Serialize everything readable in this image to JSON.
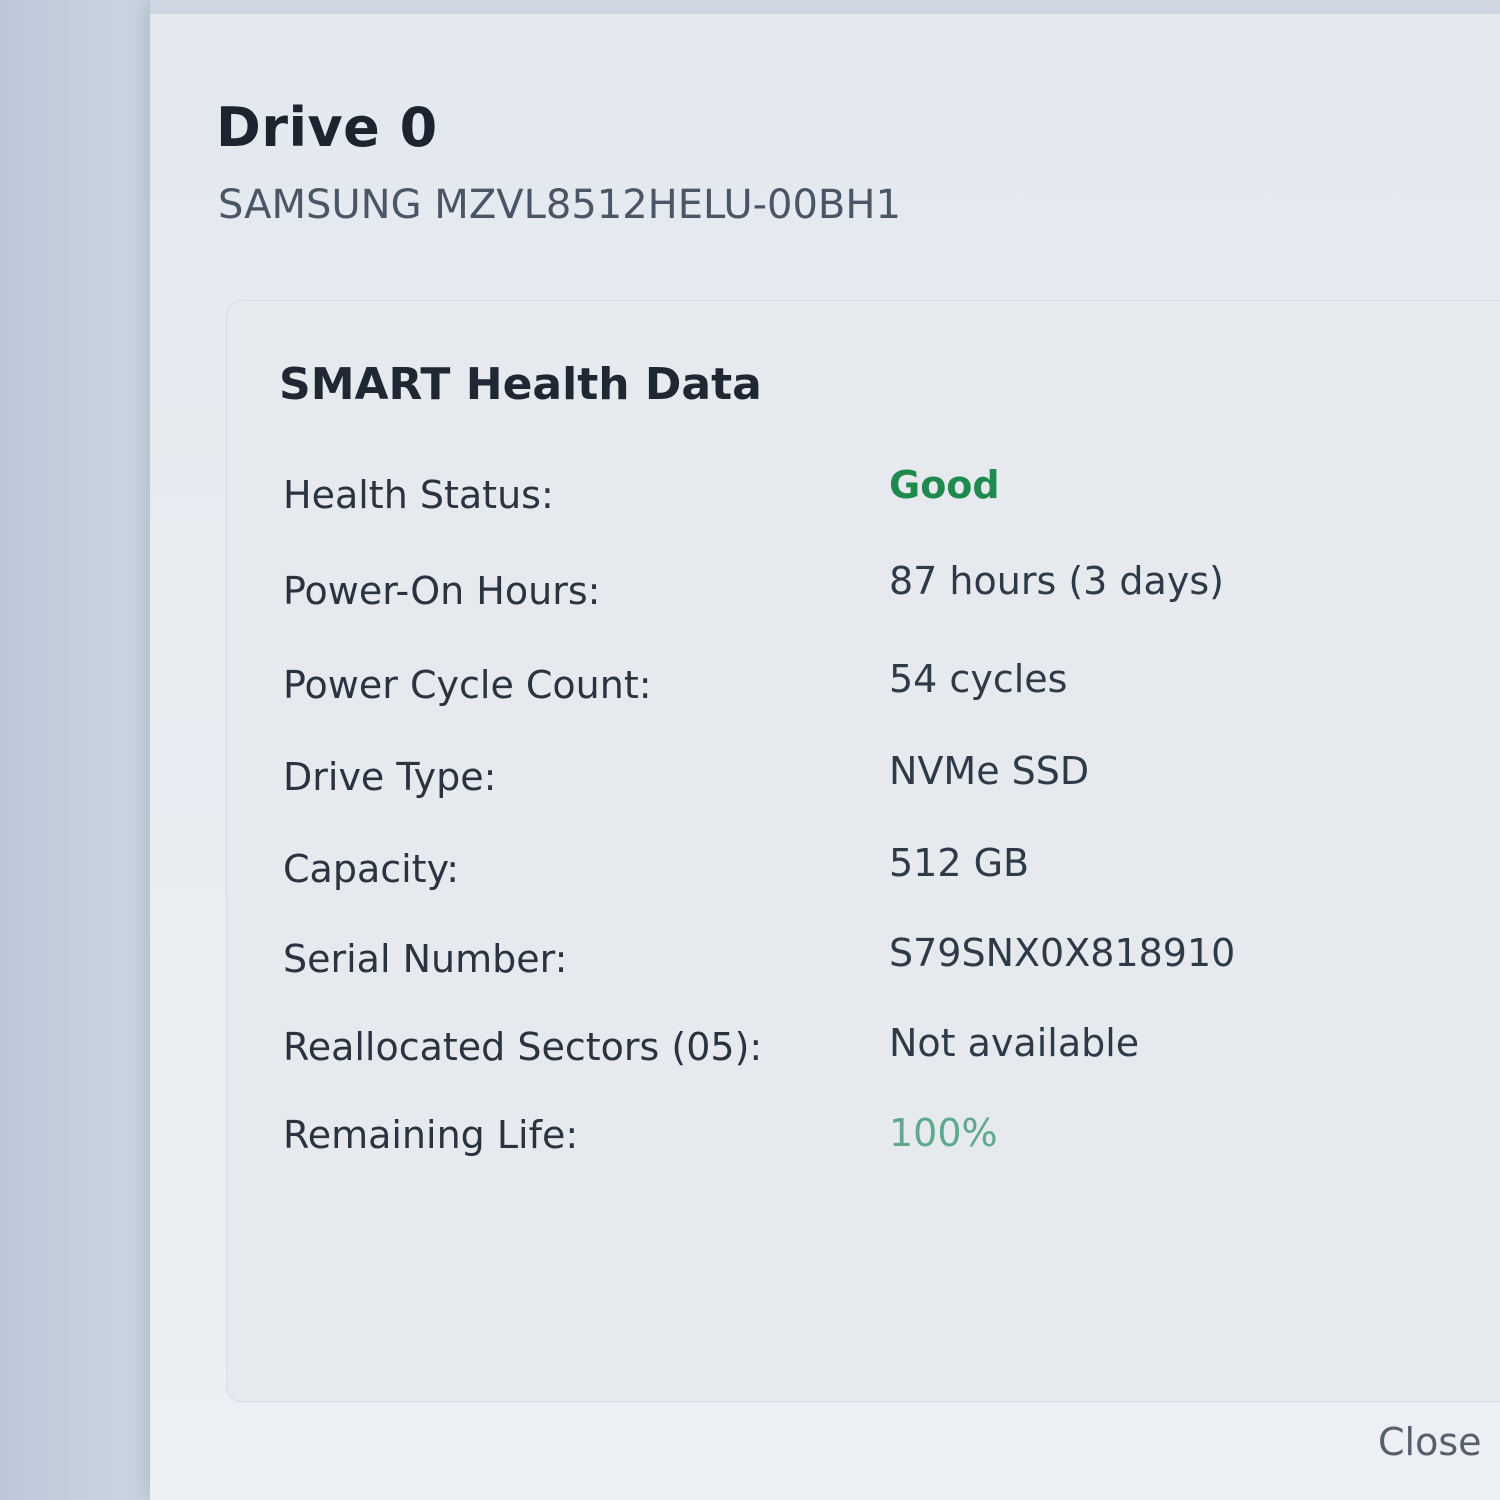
{
  "drive": {
    "title": "Drive 0",
    "model": "SAMSUNG MZVL8512HELU-00BH1"
  },
  "smart": {
    "title": "SMART Health Data",
    "rows": [
      {
        "label": "Health Status:",
        "value": "Good"
      },
      {
        "label": "Power-On Hours:",
        "value": "87 hours (3 days)"
      },
      {
        "label": "Power Cycle Count:",
        "value": "54 cycles"
      },
      {
        "label": "Drive Type:",
        "value": "NVMe SSD"
      },
      {
        "label": "Capacity:",
        "value": "512 GB"
      },
      {
        "label": "Serial Number:",
        "value": "S79SNX0X818910"
      },
      {
        "label": "Reallocated Sectors (05):",
        "value": "Not available"
      },
      {
        "label": "Remaining Life:",
        "value": "100%"
      }
    ]
  },
  "actions": {
    "close_label": "Close"
  },
  "colors": {
    "good": "#1e8a4e",
    "remaining_life": "#5fa88b"
  }
}
